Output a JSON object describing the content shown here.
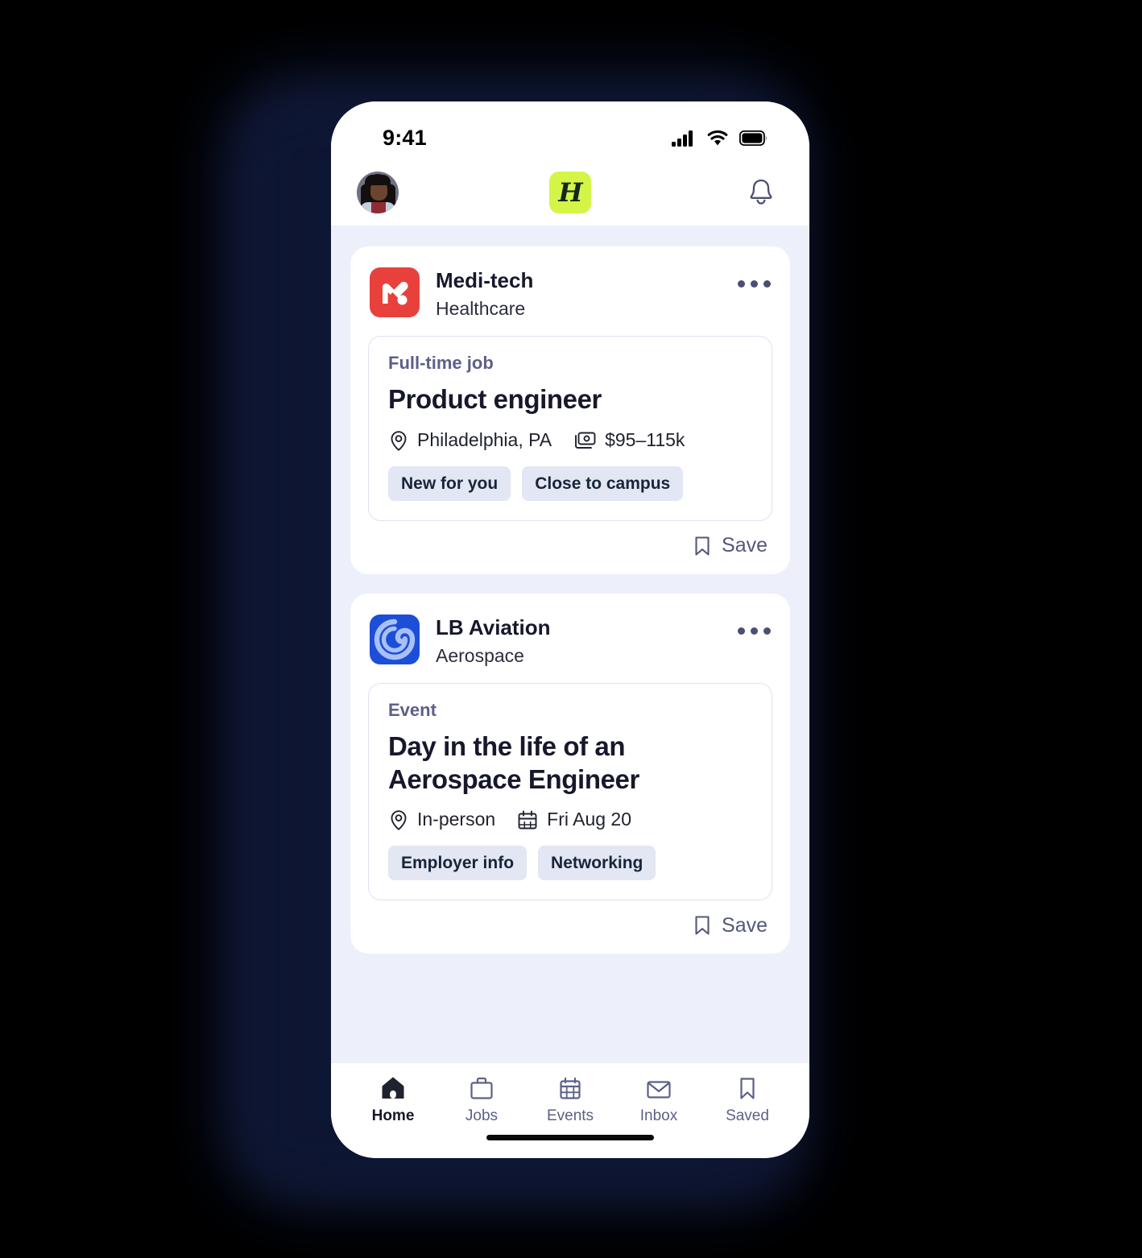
{
  "status_bar": {
    "time": "9:41",
    "icons": [
      "cellular-signal-icon",
      "wifi-icon",
      "battery-icon"
    ]
  },
  "app_header": {
    "avatar": "user-avatar",
    "brand_logo_letter": "H",
    "brand_logo_color": "#d4f547",
    "notifications_icon": "bell-icon"
  },
  "theme": {
    "screen_bg": "#edeffa",
    "card_bg": "#ffffff",
    "pill_bg": "#e3e6f3",
    "text_dark": "#17182b",
    "text_muted": "#5c6088",
    "accent_red": "#e8413c",
    "accent_blue": "#1d4ed8"
  },
  "feed": [
    {
      "org_name": "Medi-tech",
      "org_industry": "Healthcare",
      "logo": "medi-tech-logo",
      "logo_color": "#e8413c",
      "menu_icon": "more-options-icon",
      "kicker": "Full-time job",
      "headline": "Product engineer",
      "facts": [
        {
          "icon": "location-pin-icon",
          "text": "Philadelphia, PA"
        },
        {
          "icon": "money-icon",
          "text": "$95–115k"
        }
      ],
      "pills": [
        "New for you",
        "Close to campus"
      ],
      "save_label": "Save",
      "save_icon": "bookmark-icon"
    },
    {
      "org_name": "LB Aviation",
      "org_industry": "Aerospace",
      "logo": "lb-aviation-logo",
      "logo_color": "#1d4ed8",
      "menu_icon": "more-options-icon",
      "kicker": "Event",
      "headline": "Day in the life of an Aerospace Engineer",
      "facts": [
        {
          "icon": "location-pin-icon",
          "text": "In-person"
        },
        {
          "icon": "calendar-icon",
          "text": "Fri Aug 20"
        }
      ],
      "pills": [
        "Employer info",
        "Networking"
      ],
      "save_label": "Save",
      "save_icon": "bookmark-icon"
    }
  ],
  "tab_bar": {
    "items": [
      {
        "label": "Home",
        "icon": "home-icon",
        "active": true
      },
      {
        "label": "Jobs",
        "icon": "briefcase-icon",
        "active": false
      },
      {
        "label": "Events",
        "icon": "calendar-icon",
        "active": false
      },
      {
        "label": "Inbox",
        "icon": "envelope-icon",
        "active": false
      },
      {
        "label": "Saved",
        "icon": "bookmark-icon",
        "active": false
      }
    ]
  }
}
